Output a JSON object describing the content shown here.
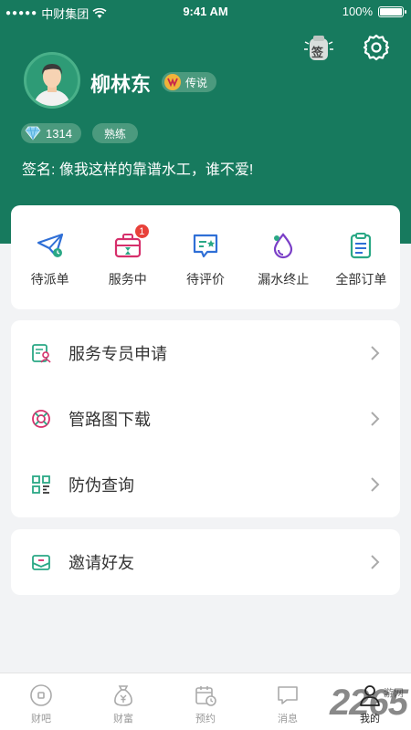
{
  "status_bar": {
    "carrier": "中财集团",
    "time": "9:41 AM",
    "battery_percent": "100%",
    "battery_level": 1.0
  },
  "header": {
    "sign_label": "签",
    "username": "柳林东",
    "rank": "传说",
    "points": "1314",
    "level": "熟练",
    "signature": "签名: 像我这样的靠谱水工，谁不爱!"
  },
  "orders": [
    {
      "label": "待派单",
      "icon": "paper-plane-icon"
    },
    {
      "label": "服务中",
      "icon": "briefcase-icon",
      "badge": "1"
    },
    {
      "label": "待评价",
      "icon": "review-chat-icon"
    },
    {
      "label": "漏水终止",
      "icon": "water-drop-icon"
    },
    {
      "label": "全部订单",
      "icon": "clipboard-icon"
    }
  ],
  "menu": [
    {
      "label": "服务专员申请",
      "icon": "specialist-apply-icon"
    },
    {
      "label": "管路图下载",
      "icon": "lifebuoy-icon"
    },
    {
      "label": "防伪查询",
      "icon": "qr-code-icon"
    }
  ],
  "invite": {
    "label": "邀请好友",
    "icon": "mail-invite-icon"
  },
  "tabs": [
    {
      "label": "财吧",
      "icon": "coin-icon"
    },
    {
      "label": "财富",
      "icon": "money-bag-icon"
    },
    {
      "label": "预约",
      "icon": "calendar-icon"
    },
    {
      "label": "消息",
      "icon": "message-icon"
    },
    {
      "label": "我的",
      "icon": "person-icon",
      "active": true
    }
  ],
  "watermark": {
    "text": "2265",
    "sub": "游网"
  },
  "colors": {
    "brand_green": "#177a5e",
    "badge_red": "#e8413a",
    "rank_gold": "#f0b33a"
  }
}
